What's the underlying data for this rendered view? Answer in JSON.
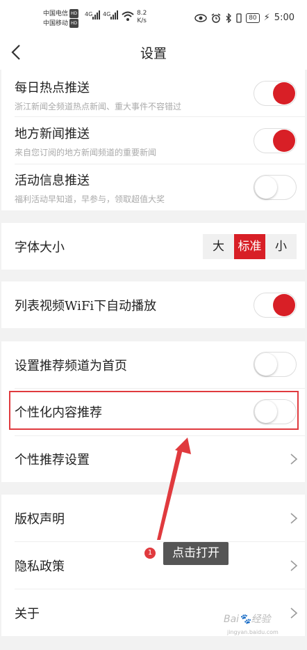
{
  "status_bar": {
    "carrier1": "中国电信",
    "carrier2": "中国移动",
    "hd": "HD",
    "net1": "4G",
    "net2": "4G",
    "speed_value": "8.2",
    "speed_unit": "K/s",
    "battery": "80",
    "time": "5:00"
  },
  "header": {
    "title": "设置"
  },
  "push_section": {
    "items": [
      {
        "label": "每日热点推送",
        "desc": "浙江新闻全频道热点新闻、重大事件不容错过",
        "on": true
      },
      {
        "label": "地方新闻推送",
        "desc": "来自您订阅的地方新闻频道的重要新闻",
        "on": true
      },
      {
        "label": "活动信息推送",
        "desc": "福利活动早知道，早参与，领取超值大奖",
        "on": false
      }
    ]
  },
  "font_size": {
    "label": "字体大小",
    "options": [
      "大",
      "标准",
      "小"
    ],
    "selected": "标准"
  },
  "video_autoplay": {
    "label": "列表视频WiFi下自动播放",
    "on": true
  },
  "recommend_section": {
    "home_channel": {
      "label": "设置推荐频道为首页",
      "on": false
    },
    "personalized": {
      "label": "个性化内容推荐",
      "on": false
    },
    "personal_settings": {
      "label": "个性推荐设置"
    }
  },
  "about_section": {
    "items": [
      {
        "label": "版权声明"
      },
      {
        "label": "隐私政策"
      },
      {
        "label": "关于"
      }
    ]
  },
  "annotation": {
    "step": "1",
    "text": "点击打开"
  },
  "colors": {
    "accent": "#d81f26",
    "highlight": "#e03a3e"
  }
}
